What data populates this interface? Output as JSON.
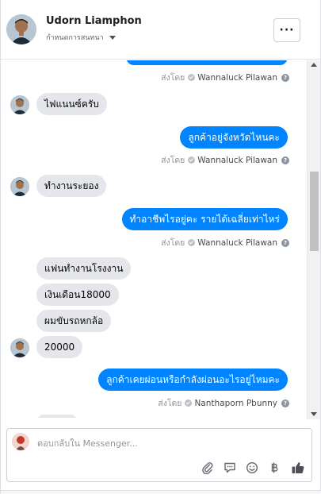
{
  "header": {
    "name": "Udorn Liamphon",
    "subtitle": "กำหนดการสนทนา",
    "more_label": "···"
  },
  "messages": [
    {
      "type": "sent_by",
      "prefix": "ส่งโดย",
      "agent": "Wannaluck Pilawan"
    },
    {
      "type": "in",
      "text": "ไฟแนนซ์ครับ"
    },
    {
      "type": "out",
      "text": "ลูกค้าอยู่จังหวัดไหนคะ"
    },
    {
      "type": "sent_by",
      "prefix": "ส่งโดย",
      "agent": "Wannaluck Pilawan"
    },
    {
      "type": "in",
      "text": "ทำงานระยอง"
    },
    {
      "type": "out",
      "text": "ทำอาชีพไรอยู่คะ รายได้เฉลี่ยเท่าไหร่"
    },
    {
      "type": "sent_by",
      "prefix": "ส่งโดย",
      "agent": "Wannaluck Pilawan"
    },
    {
      "type": "in",
      "text": "แฟนทำงานโรงงาน"
    },
    {
      "type": "in",
      "text": "เงินเดือน18000"
    },
    {
      "type": "in",
      "text": "ผมขับรถหกล้อ"
    },
    {
      "type": "in",
      "text": "20000"
    },
    {
      "type": "out",
      "text": "ลูกค้าเคยผ่อนหรือกำลังผ่อนอะไรอยู่ไหมคะ"
    },
    {
      "type": "sent_by",
      "prefix": "ส่งโดย",
      "agent": "Nanthaporn Pbunny"
    }
  ],
  "composer": {
    "placeholder": "ตอบกลับใน Messenger..."
  },
  "tools": [
    "paperclip-icon",
    "chat-bubble-icon",
    "smiley-icon",
    "baht-icon",
    "thumbs-up-icon"
  ],
  "colors": {
    "outgoing": "#0084ff",
    "incoming": "#e4e6eb",
    "meta": "#606770"
  }
}
